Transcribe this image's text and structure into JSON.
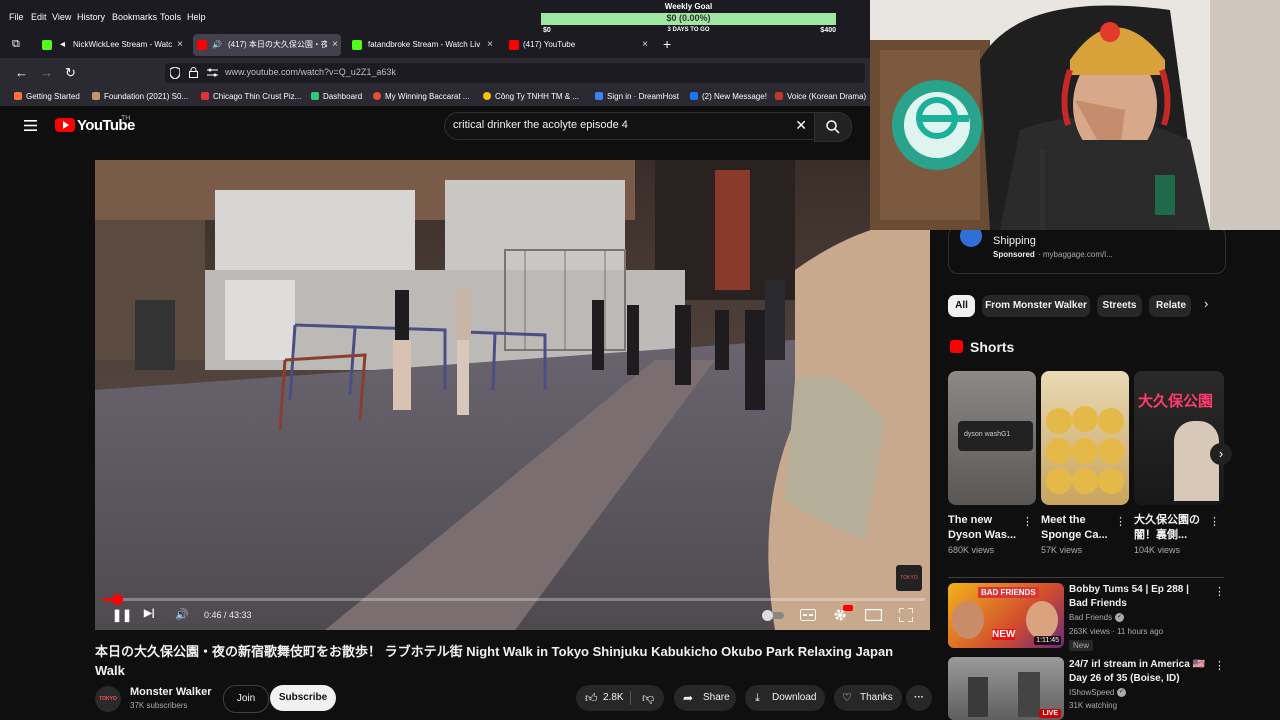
{
  "menubar": {
    "items": [
      "File",
      "Edit",
      "View",
      "History",
      "Bookmarks",
      "Tools",
      "Help"
    ]
  },
  "goal_widget": {
    "title": "Weekly Goal",
    "center": "$0 (0.00%)",
    "left": "$0",
    "mid": "3 DAYS TO GO",
    "right": "$400",
    "progress_percent": 0
  },
  "tabs": [
    {
      "label": "NickWickLee Stream - Watc",
      "favicon_color": "#53fc18"
    },
    {
      "label": "(417) 本日の大久保公園・夜",
      "favicon_color": "#ff0000",
      "audio": "🔊"
    },
    {
      "label": "fatandbroke Stream - Watch Liv",
      "favicon_color": "#53fc18"
    },
    {
      "label": "(417) YouTube",
      "favicon_color": "#ff0000"
    }
  ],
  "tab_close": "×",
  "new_tab": "+",
  "nav": {
    "back": "←",
    "forward": "→",
    "reload": "↻",
    "url": "www.youtube.com/watch?v=Q_u2Z1_a63k"
  },
  "bookmarks": [
    {
      "label": "Getting Started",
      "color": "#ff7139"
    },
    {
      "label": "Foundation (2021) S0...",
      "color": "#c19a6b"
    },
    {
      "label": "Chicago Thin Crust Piz...",
      "color": "#d33"
    },
    {
      "label": "Dashboard",
      "color": "#2ecc71"
    },
    {
      "label": "My Winning Baccarat ...",
      "color": "#e74c3c"
    },
    {
      "label": "Công Ty TNHH TM & ...",
      "color": "#f1c40f"
    },
    {
      "label": "Sign in · DreamHost",
      "color": "#3b82f6"
    },
    {
      "label": "(2) New Message!",
      "color": "#1877f2"
    },
    {
      "label": "Voice (Korean Drama)",
      "color": "#c0392b"
    }
  ],
  "youtube": {
    "wordmark": "YouTube",
    "country": "TH",
    "search_query": "critical drinker the acolyte episode 4",
    "clear": "✕"
  },
  "player": {
    "time": "0:46 / 43:33",
    "progress": 0.0176,
    "pause": "❚❚",
    "next": "▶|",
    "volume": "🔊",
    "watermark": "TOKYO"
  },
  "video": {
    "title": "本日の大久保公園・夜の新宿歌舞伎町をお散歩！ ラブホテル街 Night Walk in Tokyo Shinjuku Kabukicho Okubo Park Relaxing Japan Walk",
    "channel": "Monster Walker",
    "subscribers": "37K subscribers",
    "join": "Join",
    "subscribe": "Subscribe",
    "likes": "2.8K",
    "share": "Share",
    "download": "Download",
    "thanks": "Thanks",
    "more": "···",
    "avatar_text": "TOKYO"
  },
  "ad": {
    "title": "Shipping",
    "sponsored": "Sponsored",
    "domain": "· mybaggage.com/l..."
  },
  "chips": [
    "All",
    "From Monster Walker",
    "Streets",
    "Relate"
  ],
  "shorts_heading": "Shorts",
  "shorts": [
    {
      "title": "The new Dyson Was...",
      "views": "680K views",
      "brand": "dyson washG1"
    },
    {
      "title": "Meet the Sponge Ca...",
      "views": "57K views"
    },
    {
      "title": "大久保公園の闇！裏側...",
      "views": "104K views",
      "overlay": "大久保公園"
    }
  ],
  "recommendations": [
    {
      "title": "Bobby Tums 54 | Ep 288 | Bad Friends",
      "channel": "Bad Friends",
      "meta": "263K views · 11 hours ago",
      "badge": "New",
      "duration": "1:11:45",
      "thumb_text": "BAD FRIENDS",
      "thumb_new": "NEW"
    },
    {
      "title": "24/7 irl stream in America 🇺🇸 Day 26 of 35 (Boise, ID)",
      "channel": "IShowSpeed",
      "meta": "31K watching",
      "badge": "LIVE"
    }
  ],
  "colors": {
    "youtube_red": "#ff0000",
    "chrome_dark": "#1c1b22",
    "goal_green": "#2f9e44"
  }
}
